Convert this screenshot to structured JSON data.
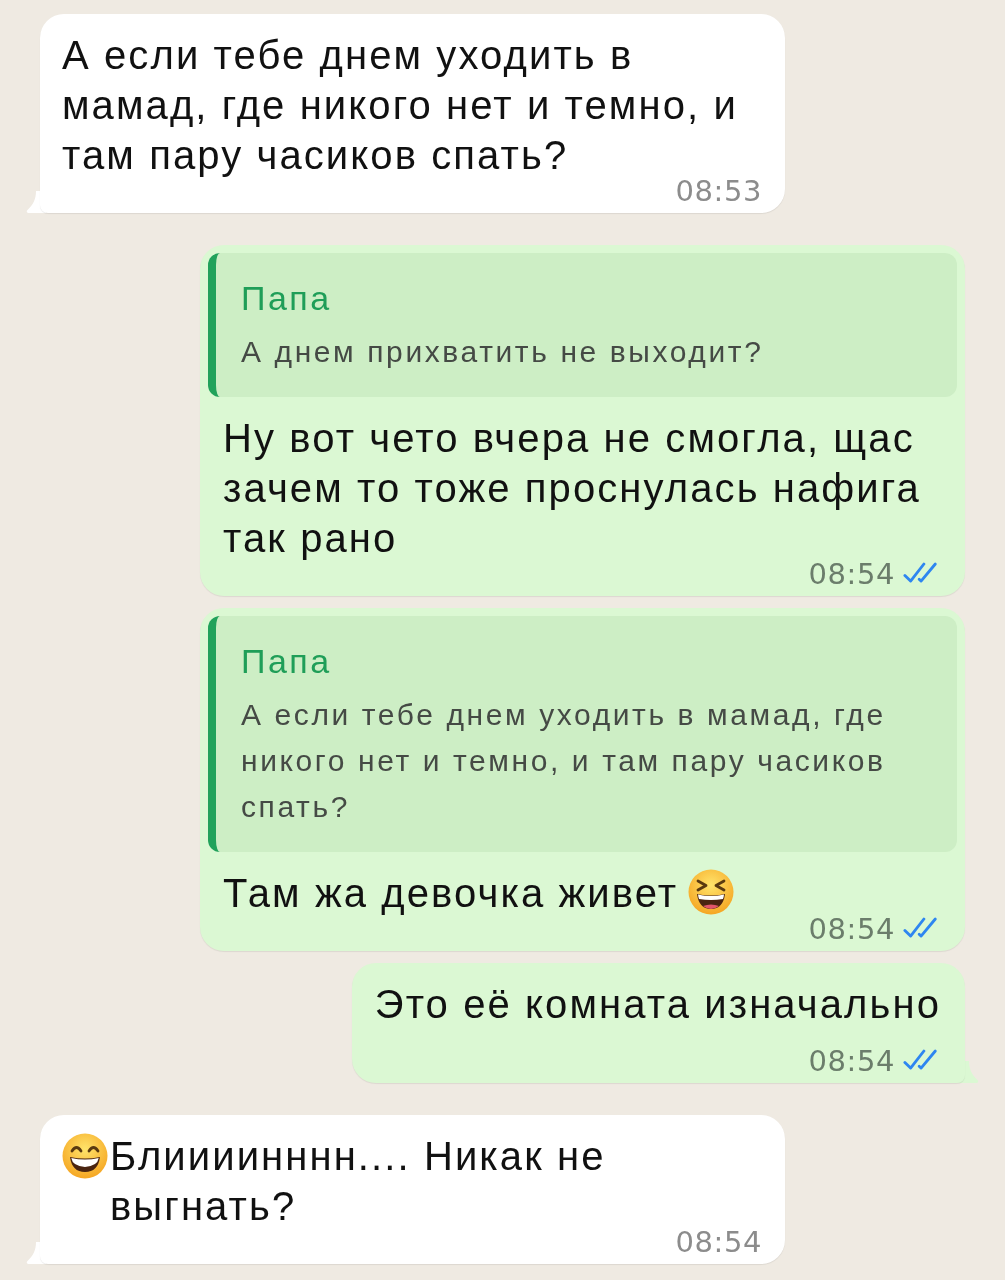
{
  "messages": [
    {
      "kind": "incoming",
      "tail": true,
      "parts": [
        {
          "kind": "text",
          "text": "А если тебе днем уходить в мамад, где никого нет и темно, и там пару часиков спать?"
        }
      ],
      "time": "08:53"
    },
    {
      "kind": "outgoing",
      "tail": false,
      "reply": {
        "author": "Папа",
        "text": "А днем прихватить не выходит?"
      },
      "parts": [
        {
          "kind": "text",
          "text": "Ну вот чето вчера не смогла, щас зачем то тоже проснулась нафига так рано"
        }
      ],
      "time": "08:54",
      "read": true
    },
    {
      "kind": "outgoing",
      "tail": false,
      "reply": {
        "author": "Папа",
        "text": "А если тебе днем уходить в мамад, где никого нет и темно, и там пару часиков спать?"
      },
      "parts": [
        {
          "kind": "text",
          "text": "Там жа девочка живет"
        },
        {
          "kind": "squinting"
        }
      ],
      "time": "08:54",
      "read": true
    },
    {
      "kind": "outgoing",
      "tail": true,
      "parts": [
        {
          "kind": "text",
          "text": "Это её комната изначально"
        }
      ],
      "time": "08:54",
      "read": true
    },
    {
      "kind": "incoming",
      "tail": true,
      "parts": [
        {
          "kind": "beaming"
        },
        {
          "kind": "text",
          "text": "Блиииинннн.... Никак не выгнать?"
        }
      ],
      "time": "08:54"
    }
  ]
}
